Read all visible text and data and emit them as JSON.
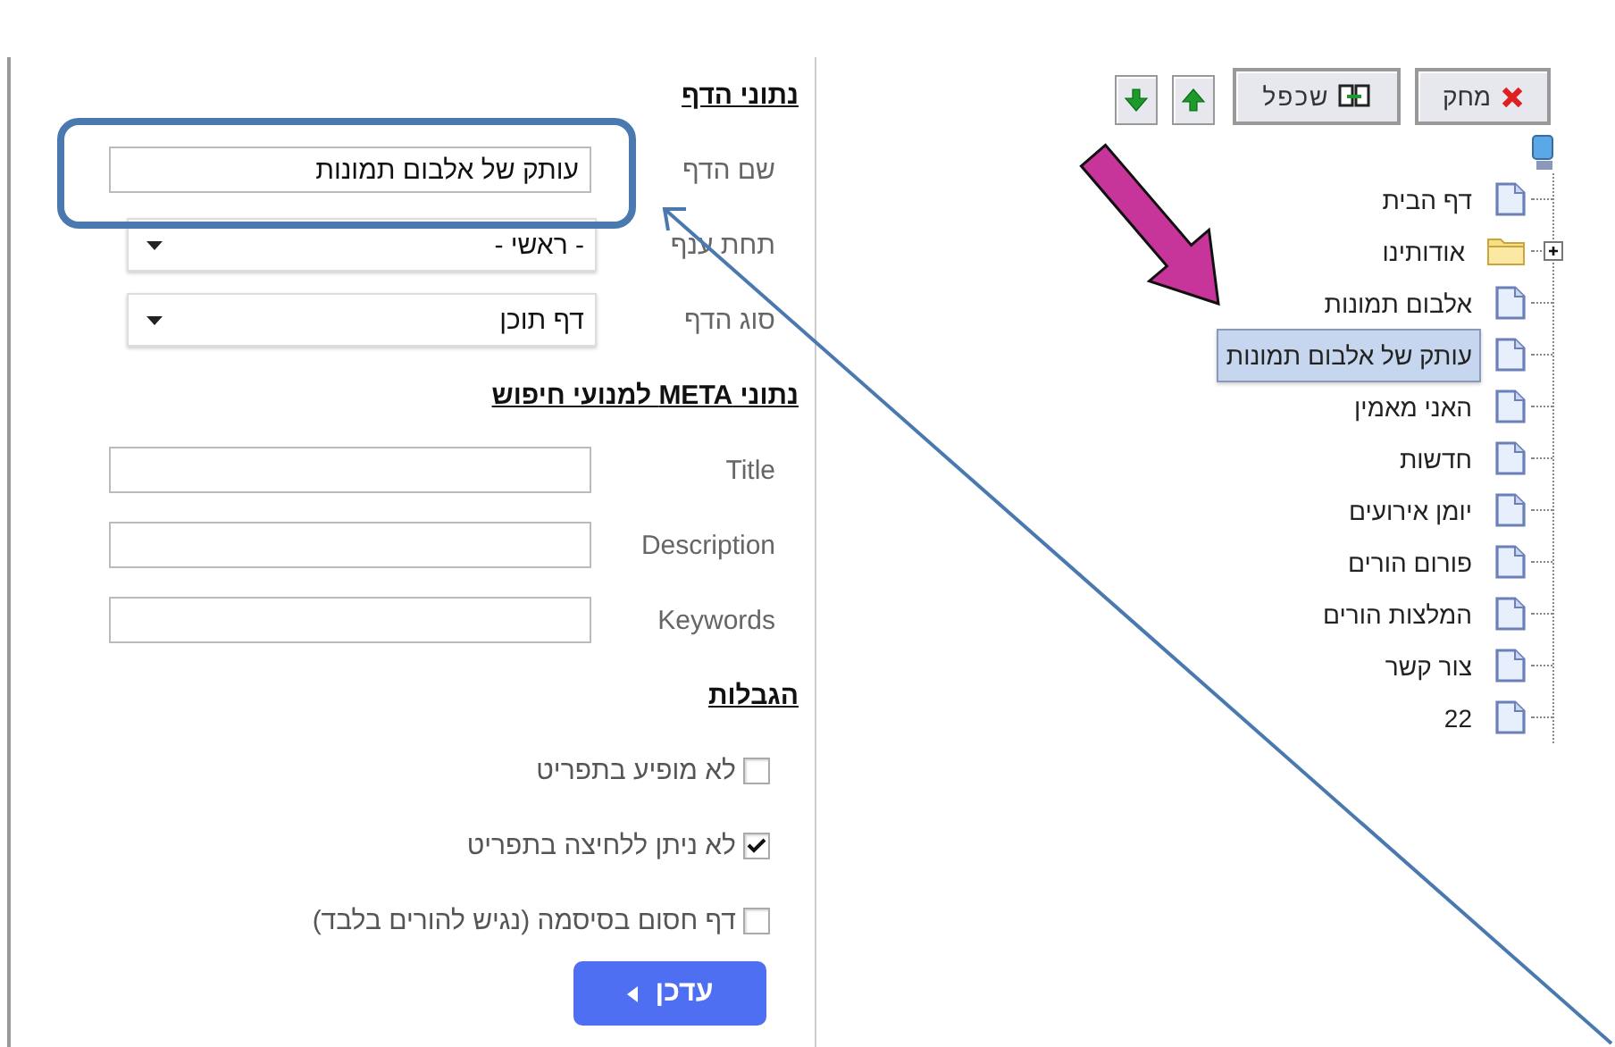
{
  "page_form": {
    "heading": "נתוני הדף",
    "fields": [
      {
        "label": "שם הדף",
        "kind": "text",
        "value": "עותק של אלבום תמונות"
      },
      {
        "label": "תחת ענף",
        "kind": "select",
        "value": "- ראשי -"
      },
      {
        "label": "סוג הדף",
        "kind": "select",
        "value": "דף תוכן"
      }
    ]
  },
  "meta_form": {
    "heading": "נתוני META למנועי חיפוש",
    "fields": [
      {
        "label": "Title",
        "kind": "text"
      },
      {
        "label": "Description",
        "kind": "text"
      },
      {
        "label": "Keywords",
        "kind": "text"
      }
    ]
  },
  "restrictions": {
    "heading": "הגבלות",
    "options": [
      {
        "label": "לא מופיע בתפריט",
        "checked": false
      },
      {
        "label": "לא ניתן ללחיצה בתפריט",
        "checked": true
      },
      {
        "label": "דף חסום בסיסמה (נגיש להורים בלבד)",
        "checked": false
      }
    ]
  },
  "update_button": {
    "label": "עדכן"
  },
  "toolbar": [
    {
      "kind": "delete",
      "label": "מחק"
    },
    {
      "kind": "duplicate",
      "label": "שכפל"
    },
    {
      "kind": "up"
    },
    {
      "kind": "down"
    }
  ],
  "tree": [
    {
      "label": "דף הבית",
      "kind": "page",
      "selected": false
    },
    {
      "label": "אודותינו",
      "kind": "folder",
      "selected": false,
      "expanded": false
    },
    {
      "label": "אלבום תמונות",
      "kind": "page",
      "selected": false
    },
    {
      "label": "עותק של אלבום תמונות",
      "kind": "page",
      "selected": true
    },
    {
      "label": "האני מאמין",
      "kind": "page",
      "selected": false
    },
    {
      "label": "חדשות",
      "kind": "page",
      "selected": false
    },
    {
      "label": "יומן אירועים",
      "kind": "page",
      "selected": false
    },
    {
      "label": "פורום הורים",
      "kind": "page",
      "selected": false
    },
    {
      "label": "המלצות הורים",
      "kind": "page",
      "selected": false
    },
    {
      "label": "צור קשר",
      "kind": "page",
      "selected": false
    },
    {
      "label": "22",
      "kind": "page",
      "selected": false
    }
  ]
}
